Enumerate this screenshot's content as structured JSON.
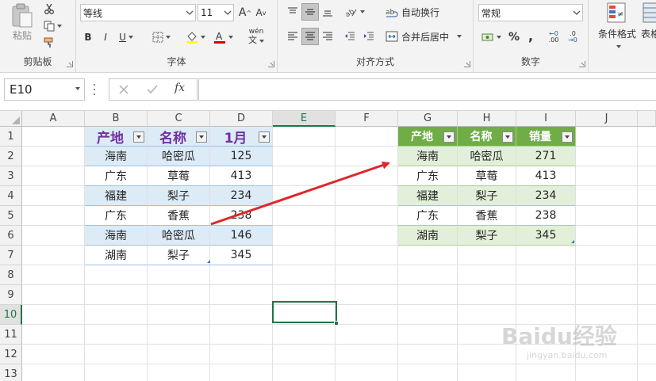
{
  "ribbon": {
    "clipboard": {
      "paste_label": "粘贴",
      "group_label": "剪贴板"
    },
    "font": {
      "font_name": "等线",
      "font_size": "11",
      "bold": "B",
      "italic": "I",
      "underline": "U",
      "wen": "wén",
      "group_label": "字体"
    },
    "alignment": {
      "wrap_text": "自动换行",
      "merge_center": "合并后居中",
      "group_label": "对齐方式"
    },
    "number": {
      "format": "常规",
      "percent": "%",
      "comma": ",",
      "inc_decimal": ".00",
      "dec_decimal": ".0",
      "group_label": "数字"
    },
    "styles": {
      "conditional": "条件格式",
      "table_fmt": "表格"
    }
  },
  "formula_bar": {
    "name_box": "E10",
    "fx": "fx",
    "formula": ""
  },
  "columns": [
    "A",
    "B",
    "C",
    "D",
    "E",
    "F",
    "G",
    "H",
    "I",
    "J"
  ],
  "rows": [
    "1",
    "2",
    "3",
    "4",
    "5",
    "6",
    "7",
    "8",
    "9",
    "10",
    "11",
    "12",
    "13"
  ],
  "selected_cell": "E10",
  "table1": {
    "headers": [
      "产地",
      "名称",
      "1月"
    ],
    "rows": [
      [
        "海南",
        "哈密瓜",
        "125"
      ],
      [
        "广东",
        "草莓",
        "413"
      ],
      [
        "福建",
        "梨子",
        "234"
      ],
      [
        "广东",
        "香蕉",
        "238"
      ],
      [
        "海南",
        "哈密瓜",
        "146"
      ],
      [
        "湖南",
        "梨子",
        "345"
      ]
    ]
  },
  "table2": {
    "headers": [
      "产地",
      "名称",
      "销量"
    ],
    "rows": [
      [
        "海南",
        "哈密瓜",
        "271"
      ],
      [
        "广东",
        "草莓",
        "413"
      ],
      [
        "福建",
        "梨子",
        "234"
      ],
      [
        "广东",
        "香蕉",
        "238"
      ],
      [
        "湖南",
        "梨子",
        "345"
      ]
    ]
  },
  "watermark": {
    "brand": "Baidu经验",
    "url": "jingyan.baidu.com"
  },
  "colors": {
    "accent": "#217346",
    "header_purple": "#7030a0",
    "table2_header": "#70ad47",
    "arrow": "#e0262b"
  }
}
